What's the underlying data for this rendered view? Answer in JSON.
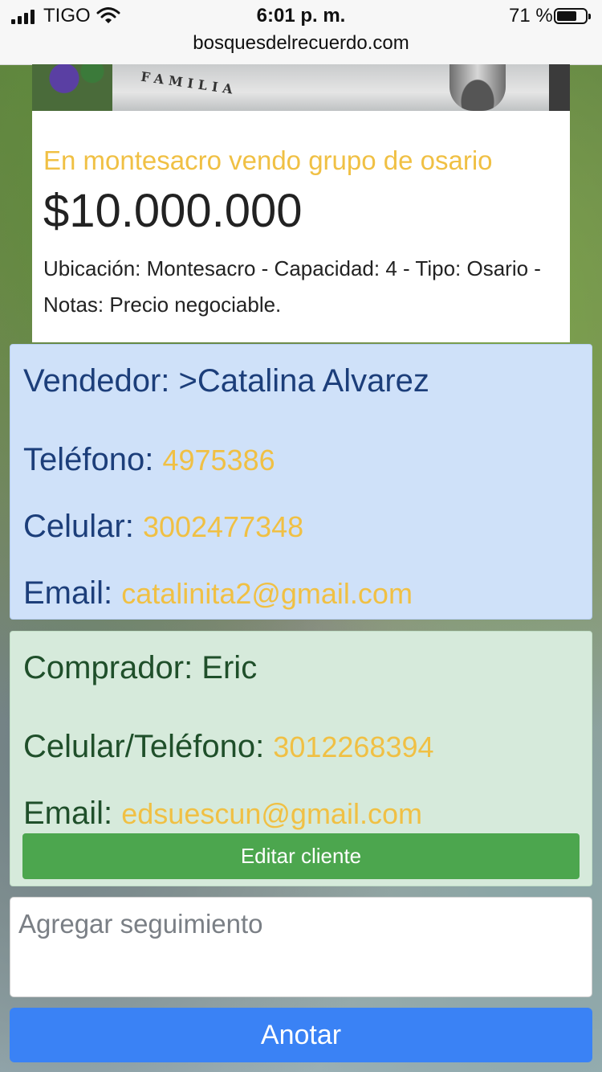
{
  "status_bar": {
    "carrier": "TIGO",
    "time": "6:01 p. m.",
    "battery_text": "71 %",
    "battery_level": 0.71,
    "url": "bosquesdelrecuerdo.com",
    "icons": [
      "signal-icon",
      "wifi-icon",
      "battery-icon"
    ]
  },
  "listing": {
    "photo_engraving": "FAMILIA ARISTIZABAL",
    "title": "En montesacro vendo grupo de osario",
    "price": "$10.000.000",
    "description": "Ubicación: Montesacro - Capacidad: 4 - Tipo: Osario - Notas: Precio negociable."
  },
  "seller": {
    "name_label": "Vendedor: >Catalina Alvarez",
    "phone_label": "Teléfono: ",
    "phone": "4975386",
    "mobile_label": "Celular: ",
    "mobile": "3002477348",
    "email_label": "Email: ",
    "email": "catalinita2@gmail.com"
  },
  "buyer": {
    "name_label": "Comprador: Eric",
    "phone_label": "Celular/Teléfono: ",
    "phone": "3012268394",
    "email_label": "Email: ",
    "email": "edsuescun@gmail.com",
    "edit_button": "Editar cliente"
  },
  "followup": {
    "placeholder": "Agregar seguimiento",
    "value": "",
    "submit_button": "Anotar"
  },
  "colors": {
    "accent_yellow": "#f0c044",
    "seller_bg": "#cfe1f9",
    "seller_text": "#1c3e7a",
    "buyer_bg": "#d6eadb",
    "buyer_text": "#1f4f2a",
    "edit_button": "#4ca64e",
    "submit_button": "#3a82f5"
  }
}
